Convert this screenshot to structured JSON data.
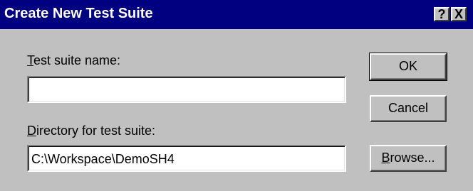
{
  "window": {
    "title": "Create New Test Suite",
    "help_label": "?",
    "close_label": "X"
  },
  "form": {
    "name_label_accel": "T",
    "name_label_rest": "est suite name:",
    "name_value": "",
    "dir_label_accel": "D",
    "dir_label_rest": "irectory for test suite:",
    "dir_value": "C:\\Workspace\\DemoSH4"
  },
  "buttons": {
    "ok_label": "OK",
    "cancel_label": "Cancel",
    "browse_accel": "B",
    "browse_rest": "rowse..."
  },
  "colors": {
    "titlebar": "#000080",
    "face": "#c0c0c0"
  }
}
